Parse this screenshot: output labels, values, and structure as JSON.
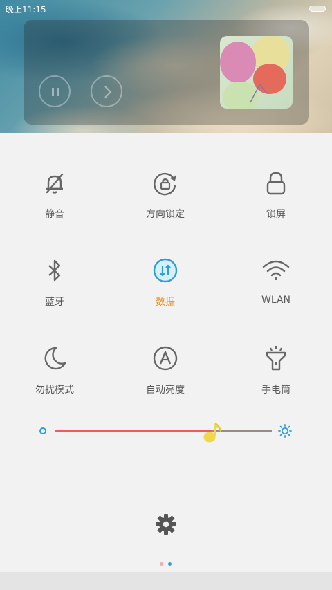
{
  "status_bar": {
    "time": "晚上11:15"
  },
  "media_player": {
    "controls": [
      "pause-icon",
      "next-icon"
    ],
    "album_art": "balloons-image"
  },
  "toggles": [
    {
      "label": "静音",
      "icon": "bell-muted-icon",
      "active": false
    },
    {
      "label": "方向锁定",
      "icon": "rotation-lock-icon",
      "active": false
    },
    {
      "label": "锁屏",
      "icon": "lock-icon",
      "active": false
    },
    {
      "label": "蓝牙",
      "icon": "bluetooth-icon",
      "active": false
    },
    {
      "label": "数据",
      "icon": "mobile-data-icon",
      "active": true
    },
    {
      "label": "WLAN",
      "icon": "wifi-icon",
      "active": false
    },
    {
      "label": "勿扰模式",
      "icon": "moon-icon",
      "active": false
    },
    {
      "label": "自动亮度",
      "icon": "auto-brightness-icon",
      "active": false
    },
    {
      "label": "手电筒",
      "icon": "flashlight-icon",
      "active": false
    }
  ],
  "brightness": {
    "level": 0.72
  },
  "pager": {
    "pages": 2,
    "current": 1
  },
  "colors": {
    "accent_active": "#e98b16",
    "data_icon": "#2aa0d8",
    "slider_fill": "#f25a5a",
    "label": "#5a5a5a"
  }
}
